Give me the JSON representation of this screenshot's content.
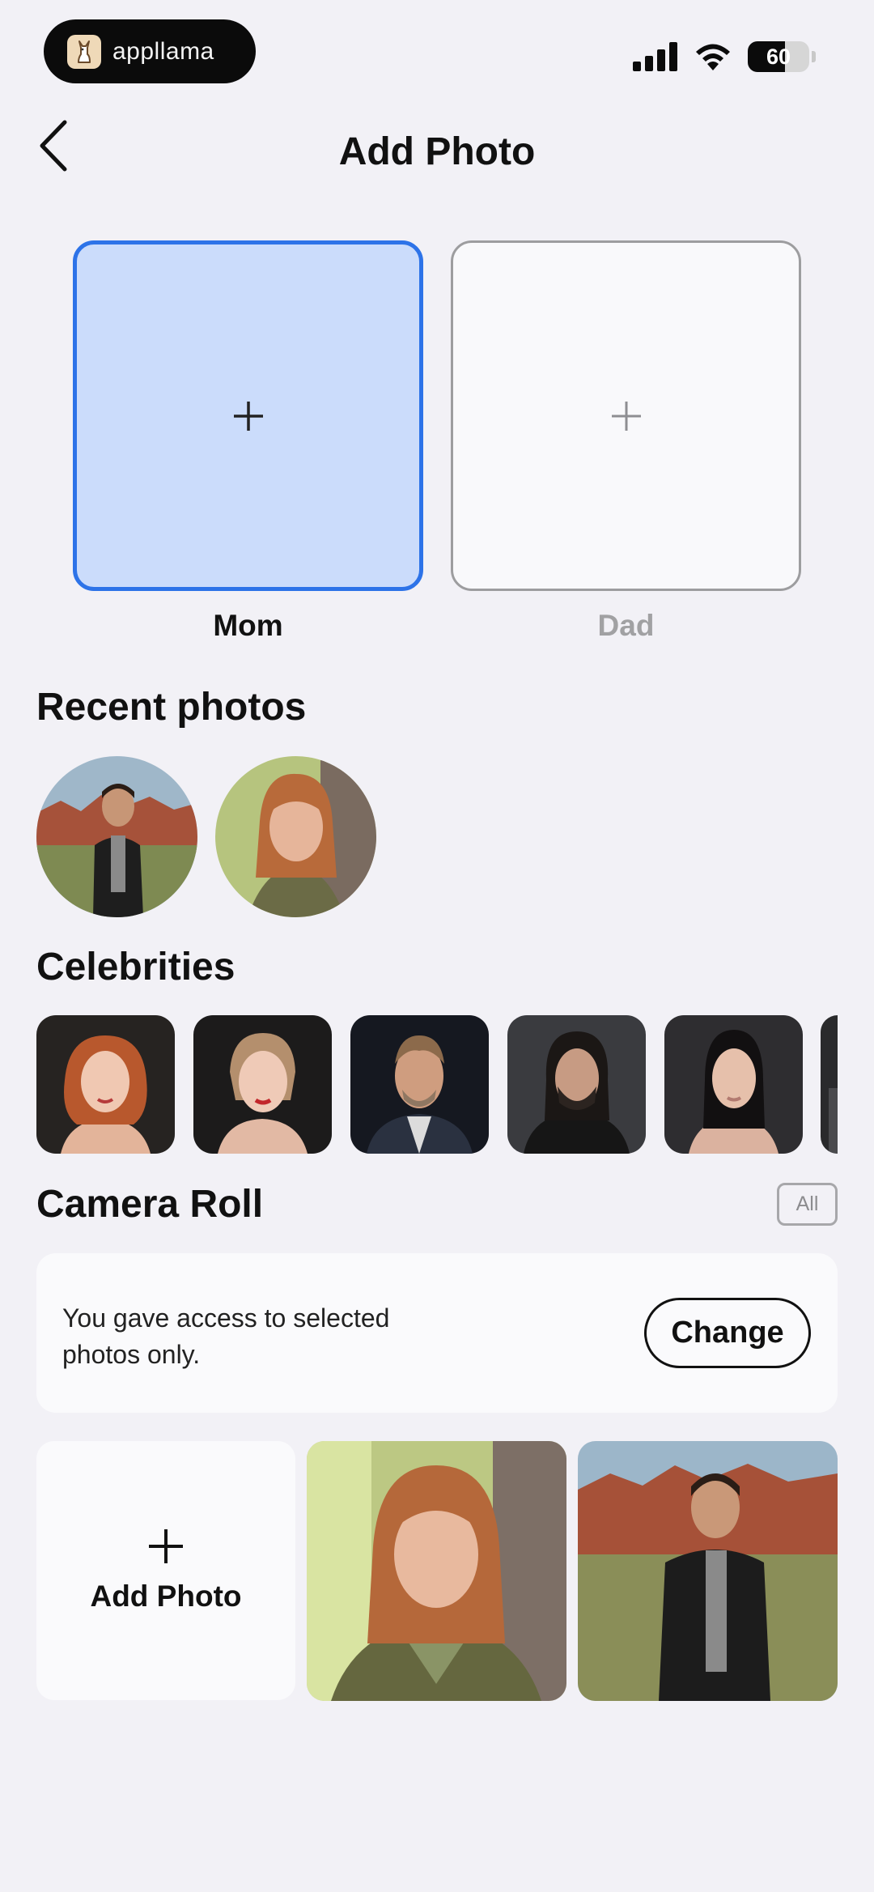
{
  "status": {
    "brand_name": "appllama",
    "battery": "60",
    "battery_level": 0.6
  },
  "header": {
    "title": "Add Photo"
  },
  "slots": {
    "mom_label": "Mom",
    "dad_label": "Dad"
  },
  "recent": {
    "title": "Recent photos"
  },
  "celebrities": {
    "title": "Celebrities"
  },
  "camera_roll": {
    "title": "Camera Roll",
    "all_label": "All",
    "access_text": "You gave access to selected photos only.",
    "change_label": "Change",
    "add_photo_label": "Add Photo"
  },
  "colors": {
    "accent": "#2d73e8",
    "selected_fill": "#cbdcfb",
    "background": "#f2f1f6"
  }
}
